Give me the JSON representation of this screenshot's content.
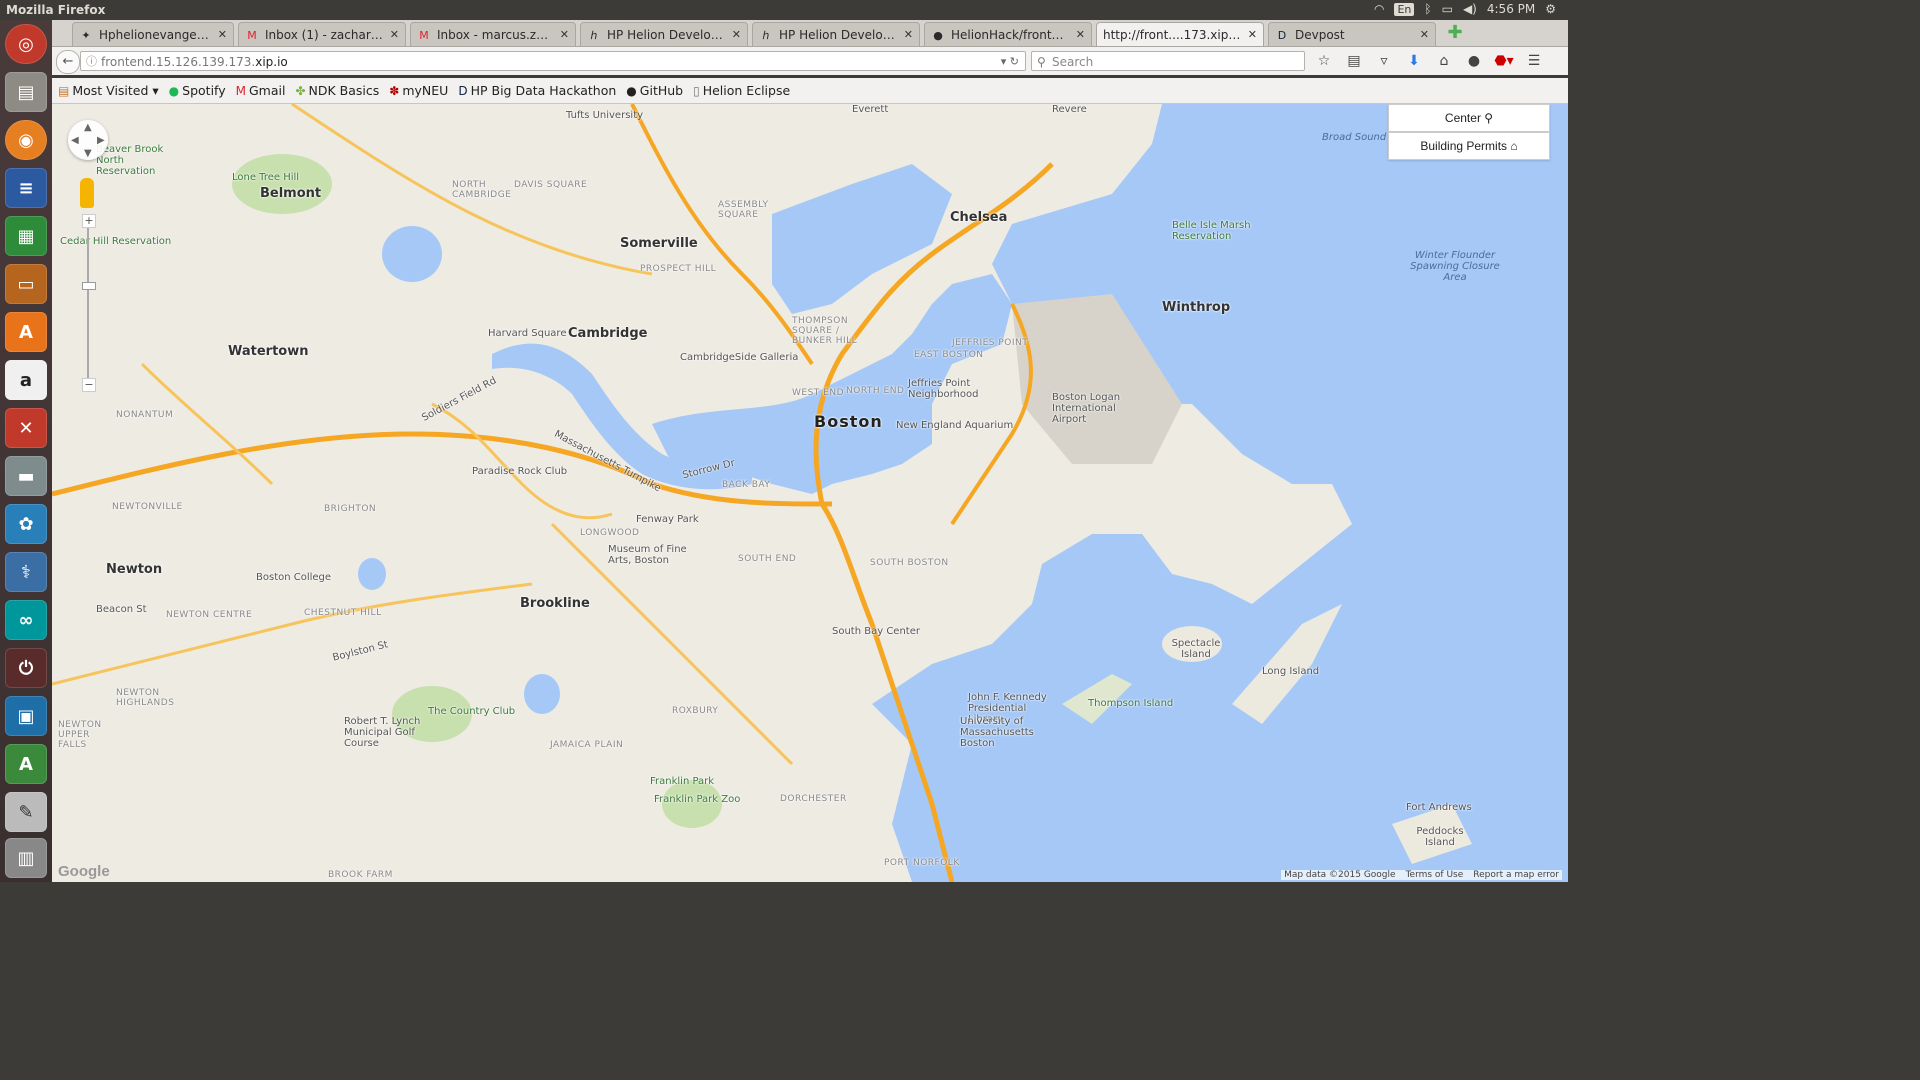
{
  "os": {
    "window_title": "Mozilla Firefox",
    "tray": {
      "lang": "En",
      "time": "4:56 PM"
    }
  },
  "tabs": [
    {
      "label": "Hphelionevangelism...",
      "icon": "puzzle-icon",
      "active": false
    },
    {
      "label": "Inbox (1) - zachary.j....",
      "icon": "gmail-icon",
      "active": false
    },
    {
      "label": "Inbox - marcus.z@h...",
      "icon": "gmail-icon",
      "active": false
    },
    {
      "label": "HP Helion Developm...",
      "icon": "hp-icon",
      "active": false
    },
    {
      "label": "HP Helion Developm...",
      "icon": "hp-icon",
      "active": false
    },
    {
      "label": "HelionHack/fronten...",
      "icon": "github-icon",
      "active": false
    },
    {
      "label": "http://front....173.xip.io/",
      "icon": "",
      "active": true
    },
    {
      "label": "Devpost",
      "icon": "devpost-icon",
      "active": false
    }
  ],
  "nav": {
    "url_prefix": "frontend.15.126.139.173.",
    "url_host": "xip.io",
    "search_placeholder": "Search"
  },
  "bookmarks": [
    {
      "label": "Most Visited ▾",
      "icon": "most-visited-icon"
    },
    {
      "label": "Spotify",
      "icon": "spotify-icon"
    },
    {
      "label": "Gmail",
      "icon": "gmail-icon"
    },
    {
      "label": "NDK Basics",
      "icon": "android-icon"
    },
    {
      "label": "myNEU",
      "icon": "paw-icon"
    },
    {
      "label": "HP Big Data Hackathon",
      "icon": "devpost-icon"
    },
    {
      "label": "GitHub",
      "icon": "github-icon"
    },
    {
      "label": "Helion Eclipse",
      "icon": "page-icon"
    }
  ],
  "map": {
    "buttons": {
      "center": "Center",
      "permits": "Building Permits"
    },
    "attribution": {
      "data": "Map data ©2015 Google",
      "terms": "Terms of Use",
      "report": "Report a map error"
    },
    "logo": "Google",
    "labels": {
      "boston": "Boston",
      "cambridge": "Cambridge",
      "somerville": "Somerville",
      "brookline": "Brookline",
      "newton": "Newton",
      "watertown": "Watertown",
      "belmont": "Belmont",
      "chelsea": "Chelsea",
      "winthrop": "Winthrop",
      "everett": "Everett",
      "revere": "Revere",
      "brighton": "BRIGHTON",
      "logan": "Boston Logan International Airport",
      "aquarium": "New England Aquarium",
      "fenway": "Fenway Park",
      "harvard_sq": "Harvard Square",
      "galleria": "CambridgeSide Galleria",
      "tufts": "Tufts University",
      "bc": "Boston College",
      "mfa": "Museum of Fine Arts, Boston",
      "paradise": "Paradise Rock Club",
      "south_bay": "South Bay Center",
      "jfk": "John F. Kennedy Presidential Library...",
      "umass": "University of Massachusetts Boston",
      "spectacle": "Spectacle Island",
      "long_island": "Long Island",
      "thompson": "Thompson Island",
      "fort_andrews": "Fort Andrews",
      "peddocks": "Peddocks Island",
      "broad_sound": "Broad Sound",
      "winter_flounder": "Winter Flounder Spawning Closure Area",
      "belle_isle": "Belle Isle Marsh Reservation",
      "jeffries": "Jeffries Point Neighborhood",
      "country_club": "The Country Club",
      "franklin_park": "Franklin Park",
      "franklin_zoo": "Franklin Park Zoo",
      "lone_tree": "Lone Tree Hill",
      "cedar_hill": "Cedar Hill Reservation",
      "beaver_brook": "Beaver Brook North Reservation",
      "lynch": "Robert T. Lynch Municipal Golf Course",
      "east_boston": "EAST BOSTON",
      "south_boston": "SOUTH BOSTON",
      "roxbury": "ROXBURY",
      "dorchester": "DORCHESTER",
      "jamaica_plain": "JAMAICA PLAIN",
      "back_bay": "BACK BAY",
      "south_end": "SOUTH END",
      "north_end": "NORTH END",
      "west_end": "WEST END",
      "longwood": "LONGWOOD",
      "chestnut_hill": "CHESTNUT HILL",
      "newton_centre": "NEWTON CENTRE",
      "newtonville": "NEWTONVILLE",
      "nonantum": "NONANTUM",
      "north_cambridge": "NORTH CAMBRIDGE",
      "davis_square": "DAVIS SQUARE",
      "assembly_square": "ASSEMBLY SQUARE",
      "prospect_hill": "PROSPECT HILL",
      "thompson_square": "THOMPSON SQUARE / BUNKER HILL",
      "jeffries_point_hood": "JEFFRIES POINT",
      "soldiers_field": "Soldiers Field Rd",
      "mass_pike": "Massachusetts Turnpike",
      "storrow": "Storrow Dr",
      "boylston": "Boylston St",
      "beacon": "Beacon St",
      "port_norfolk": "PORT NORFOLK",
      "brook_farm": "BROOK FARM",
      "newton_upper_falls": "NEWTON UPPER FALLS",
      "newton_highlands": "NEWTON HIGHLANDS"
    }
  }
}
